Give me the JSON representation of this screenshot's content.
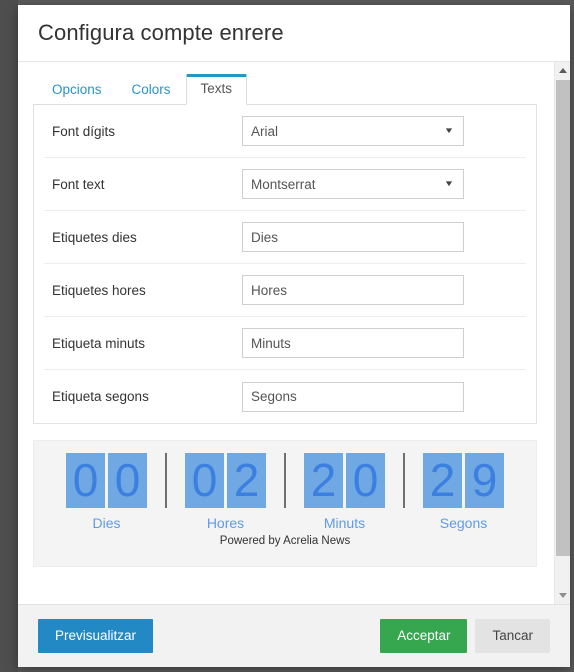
{
  "window": {
    "title": "Configura compte enrere"
  },
  "tabs": [
    {
      "label": "Opcions",
      "active": false
    },
    {
      "label": "Colors",
      "active": false
    },
    {
      "label": "Texts",
      "active": true
    }
  ],
  "form": {
    "rows": [
      {
        "label": "Font dígits",
        "type": "select",
        "value": "Arial"
      },
      {
        "label": "Font text",
        "type": "select",
        "value": "Montserrat"
      },
      {
        "label": "Etiquetes dies",
        "type": "text",
        "value": "Dies",
        "placeholder": "Dies"
      },
      {
        "label": "Etiquetes hores",
        "type": "text",
        "value": "Hores",
        "placeholder": "Hores"
      },
      {
        "label": "Etiqueta minuts",
        "type": "text",
        "value": "Minuts",
        "placeholder": "Minuts"
      },
      {
        "label": "Etiqueta segons",
        "type": "text",
        "value": "Segons",
        "placeholder": "Segons"
      }
    ],
    "caret_glyph": "▼"
  },
  "preview": {
    "units": [
      {
        "label": "Dies",
        "digits": [
          "0",
          "0"
        ]
      },
      {
        "label": "Hores",
        "digits": [
          "0",
          "2"
        ]
      },
      {
        "label": "Minuts",
        "digits": [
          "2",
          "0"
        ]
      },
      {
        "label": "Segons",
        "digits": [
          "2",
          "9"
        ]
      }
    ],
    "powered_by": "Powered by Acrelia News",
    "tile_color": "#6fa8e2",
    "digit_color": "#3b7fe0",
    "label_color": "#5f9bea",
    "background": "#f4f4f4"
  },
  "footer": {
    "preview_label": "Previsualitzar",
    "accept_label": "Acceptar",
    "close_label": "Tancar",
    "preview_color": "#2389c4",
    "accept_color": "#36a64f",
    "close_color": "#e3e3e3"
  },
  "scrollbar": {
    "up_arrow": "scroll-up-arrow",
    "down_arrow": "scroll-down-arrow"
  }
}
